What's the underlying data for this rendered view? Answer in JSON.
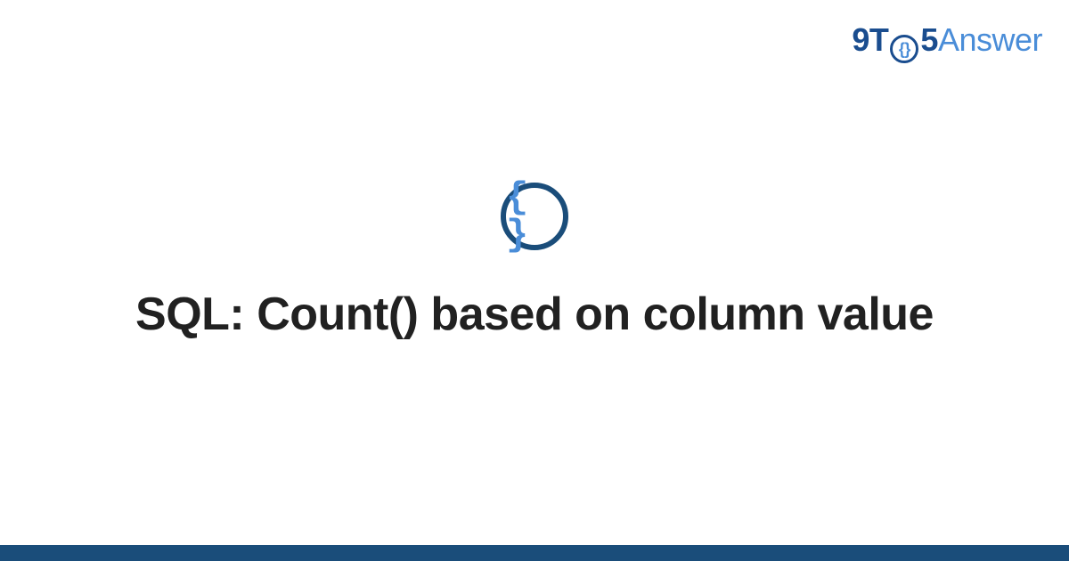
{
  "header": {
    "logo": {
      "prefix": "9T",
      "circle_content": "{}",
      "suffix_num": "5",
      "suffix_word": "Answer"
    }
  },
  "main": {
    "icon_glyph": "{ }",
    "title": "SQL: Count() based on column value"
  },
  "colors": {
    "brand_dark": "#1a4d7a",
    "brand_light": "#4a8dd8",
    "text": "#212121"
  }
}
